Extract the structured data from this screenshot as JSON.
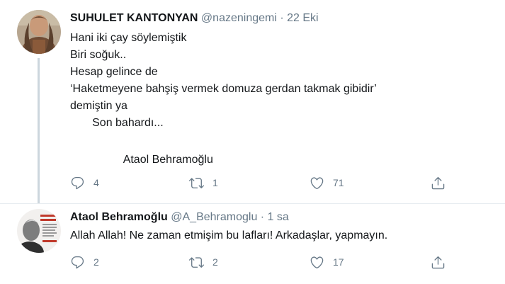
{
  "tweets": [
    {
      "display_name": "SUHULET KANTONYAN",
      "handle": "@nazeningemi",
      "separator": "·",
      "time": "22 Eki",
      "lines": [
        "Hani iki çay söylemiştik",
        "Biri soğuk..",
        "Hesap gelince de",
        "‘Haketmeyene bahşiş vermek domuza gerdan takmak gibidir’",
        "demiştin ya",
        "       Son bahardı...",
        "",
        "                 Ataol Behramoğlu"
      ],
      "reply_count": "4",
      "retweet_count": "1",
      "like_count": "71"
    },
    {
      "display_name": "Ataol Behramoğlu",
      "handle": "@A_Behramoglu",
      "separator": "·",
      "time": "1 sa",
      "lines": [
        "Allah Allah! Ne zaman etmişim bu lafları! Arkadaşlar, yapmayın."
      ],
      "reply_count": "2",
      "retweet_count": "2",
      "like_count": "17"
    }
  ],
  "icons": {
    "reply": "reply-icon",
    "retweet": "retweet-icon",
    "like": "heart-icon",
    "share": "share-icon"
  },
  "colors": {
    "text": "#14171a",
    "secondary": "#657786",
    "thread_line": "#ccd6dd",
    "divider": "#e6ecf0"
  }
}
